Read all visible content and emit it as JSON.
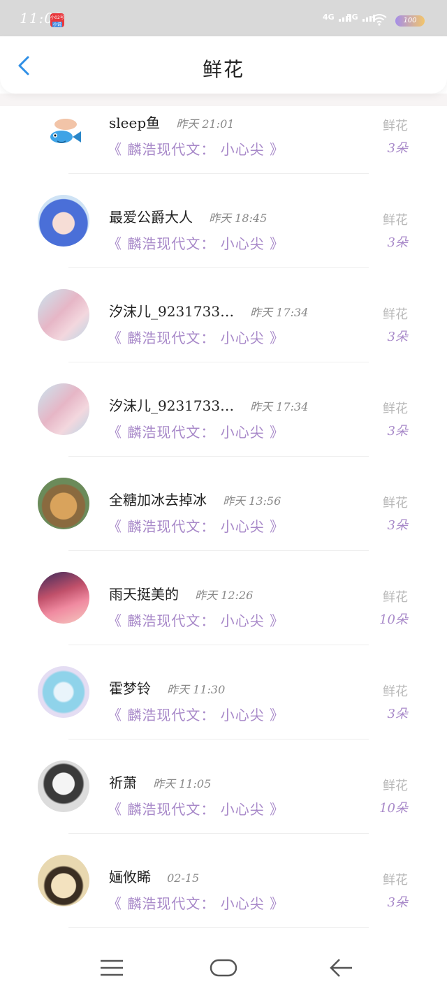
{
  "status_bar": {
    "time": "11:02",
    "app_badge_top": "小02号",
    "app_badge_bottom": "小说",
    "network1": "4G",
    "network2": "5G",
    "battery": "100",
    "icons": [
      "signal-icon",
      "wifi-icon",
      "battery-icon"
    ]
  },
  "header": {
    "title": "鲜花",
    "back_icon": "chevron-left-icon"
  },
  "colors": {
    "accent_purple": "#a889c9",
    "back_blue": "#2f8fe6",
    "muted": "#b8b8b8"
  },
  "list": [
    {
      "name": "sleep鱼",
      "time": "昨天 21:01",
      "work": "《 麟浩现代文： 小心尖 》",
      "gift_label": "鲜花",
      "gift_count": "3朵",
      "avatar": "fish-avatar"
    },
    {
      "name": "最爱公爵大人",
      "time": "昨天 18:45",
      "work": "《 麟浩现代文： 小心尖 》",
      "gift_label": "鲜花",
      "gift_count": "3朵",
      "avatar": "anime-blue-hair-avatar"
    },
    {
      "name": "汐沫儿_9231733…",
      "time": "昨天 17:34",
      "work": "《 麟浩现代文： 小心尖 》",
      "gift_label": "鲜花",
      "gift_count": "3朵",
      "avatar": "anime-pink-girl-avatar"
    },
    {
      "name": "汐沫儿_9231733…",
      "time": "昨天 17:34",
      "work": "《 麟浩现代文： 小心尖 》",
      "gift_label": "鲜花",
      "gift_count": "3朵",
      "avatar": "anime-pink-girl-avatar"
    },
    {
      "name": "全糖加冰去掉冰",
      "time": "昨天 13:56",
      "work": "《 麟浩现代文： 小心尖 》",
      "gift_label": "鲜花",
      "gift_count": "3朵",
      "avatar": "dog-avatar"
    },
    {
      "name": "雨天挺美的",
      "time": "昨天 12:26",
      "work": "《 麟浩现代文： 小心尖 》",
      "gift_label": "鲜花",
      "gift_count": "10朵",
      "avatar": "anime-sunset-avatar"
    },
    {
      "name": "霍梦铃",
      "time": "昨天 11:30",
      "work": "《 麟浩现代文： 小心尖 》",
      "gift_label": "鲜花",
      "gift_count": "3朵",
      "avatar": "anime-cat-ear-avatar"
    },
    {
      "name": "祈萧",
      "time": "昨天 11:05",
      "work": "《 麟浩现代文： 小心尖 》",
      "gift_label": "鲜花",
      "gift_count": "10朵",
      "avatar": "anime-sketch-avatar"
    },
    {
      "name": "婳攸睎",
      "time": "02-15",
      "work": "《 麟浩现代文： 小心尖 》",
      "gift_label": "鲜花",
      "gift_count": "3朵",
      "avatar": "anime-witch-avatar"
    }
  ],
  "nav": {
    "menu_icon": "menu-icon",
    "home_icon": "home-icon",
    "back_icon": "back-arrow-icon"
  }
}
